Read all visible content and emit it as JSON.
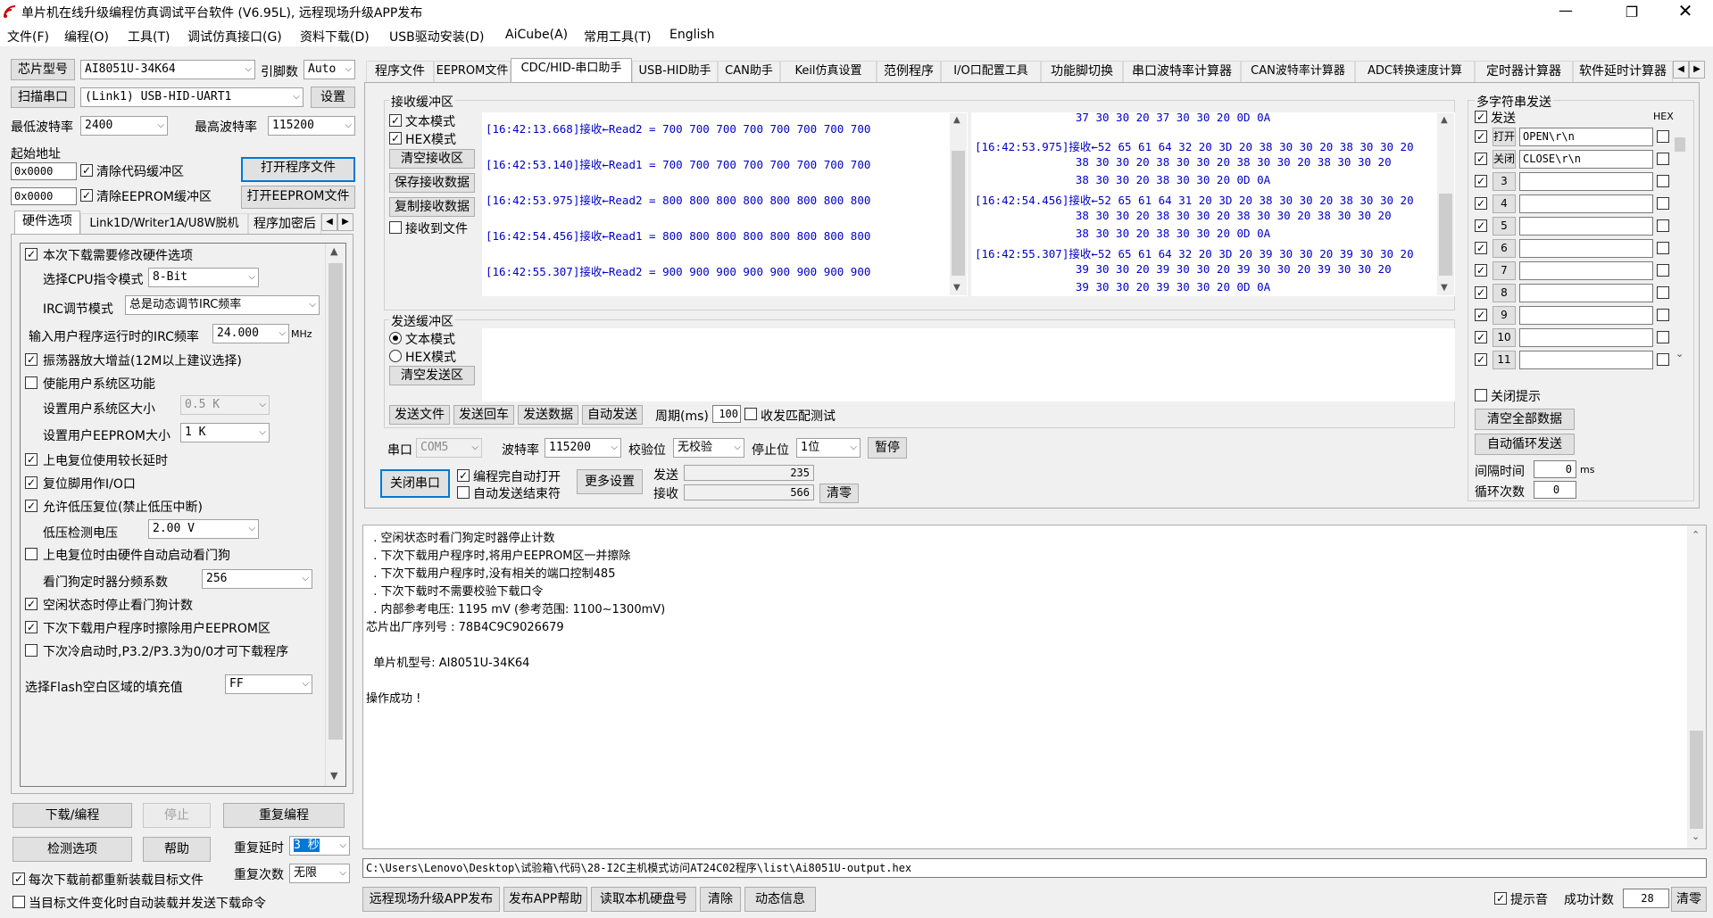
{
  "window": {
    "title": "单片机在线升级编程仿真调试平台软件 (V6.95L), 远程现场升级APP发布"
  },
  "menu": [
    "文件(F)",
    "编程(O)",
    "工具(T)",
    "调试仿真接口(G)",
    "资料下载(D)",
    "USB驱动安装(D)",
    "AiCube(A)",
    "常用工具(T)",
    "English"
  ],
  "left": {
    "chip_btn": "芯片型号",
    "chip": "AI8051U-34K64",
    "pins_lbl": "引脚数",
    "pins": "Auto",
    "scan_btn": "扫描串口",
    "port": "(Link1) USB-HID-UART1",
    "settings_btn": "设置",
    "min_baud_lbl": "最低波特率",
    "min_baud": "2400",
    "max_baud_lbl": "最高波特率",
    "max_baud": "115200",
    "start_addr_lbl": "起始地址",
    "addr1": "0x0000",
    "clear_code_lbl": "清除代码缓冲区",
    "open_prog_btn": "打开程序文件",
    "addr2": "0x0000",
    "clear_eep_lbl": "清除EEPROM缓冲区",
    "open_eep_btn": "打开EEPROM文件",
    "tabs": [
      "硬件选项",
      "Link1D/Writer1A/U8W脱机",
      "程序加密后"
    ],
    "hw": {
      "opt_modify": "本次下载需要修改硬件选项",
      "cpu_lbl": "选择CPU指令模式",
      "cpu": "8-Bit",
      "irc_lbl": "IRC调节模式",
      "irc": "总是动态调节IRC频率",
      "freq_lbl": "输入用户程序运行时的IRC频率",
      "freq": "24.000",
      "freq_unit": "MHz",
      "osc": "振荡器放大增益(12M以上建议选择)",
      "usr_sys": "使能用户系统区功能",
      "usr_sys_size_lbl": "设置用户系统区大小",
      "usr_sys_size": "0.5 K",
      "usr_eep_lbl": "设置用户EEPROM大小",
      "usr_eep": "1   K",
      "por_delay": "上电复位使用较长延时",
      "reset_io": "复位脚用作I/O口",
      "lvr": "允许低压复位(禁止低压中断)",
      "lvd_lbl": "低压检测电压",
      "lvd": "2.00 V",
      "wdt_por": "上电复位时由硬件自动启动看门狗",
      "wdt_div_lbl": "看门狗定时器分频系数",
      "wdt_div": "256",
      "wdt_idle": "空闲状态时停止看门狗计数",
      "erase_eep": "下次下载用户程序时擦除用户EEPROM区",
      "p32": "下次冷启动时,P3.2/P3.3为0/0才可下载程序",
      "fill_lbl": "选择Flash空白区域的填充值",
      "fill": "FF"
    },
    "download_btn": "下载/编程",
    "stop_btn": "停止",
    "reprog_btn": "重复编程",
    "check_btn": "检测选项",
    "help_btn": "帮助",
    "rep_delay_lbl": "重复延时",
    "rep_delay": "3 秒",
    "rep_count_lbl": "重复次数",
    "rep_count": "无限",
    "reload_lbl": "每次下载前都重新装载目标文件",
    "auto_lbl": "当目标文件变化时自动装载并发送下载命令"
  },
  "tabs": [
    "程序文件",
    "EEPROM文件",
    "CDC/HID-串口助手",
    "USB-HID助手",
    "CAN助手",
    "Keil仿真设置",
    "范例程序",
    "I/O口配置工具",
    "功能脚切换",
    "串口波特率计算器",
    "CAN波特率计算器",
    "ADC转换速度计算",
    "定时器计算器",
    "软件延时计算器"
  ],
  "rx": {
    "title": "接收缓冲区",
    "text_mode": "文本模式",
    "hex_mode": "HEX模式",
    "clear_btn": "清空接收区",
    "save_btn": "保存接收数据",
    "copy_btn": "复制接收数据",
    "to_file": "接收到文件",
    "lines": [
      "[16:42:13.668]接收←Read2 = 700 700 700 700 700 700 700 700",
      "[16:42:53.140]接收←Read1 = 700 700 700 700 700 700 700 700",
      "[16:42:53.975]接收←Read2 = 800 800 800 800 800 800 800 800",
      "[16:42:54.456]接收←Read1 = 800 800 800 800 800 800 800 800",
      "[16:42:55.307]接收←Read2 = 900 900 900 900 900 900 900 900"
    ],
    "hex_lines": [
      "               37 30 30 20 37 30 30 20 0D 0A",
      "[16:42:53.975]接收←52 65 61 64 32 20 3D 20 38 30 30 20 38 30 30 20",
      "               38 30 30 20 38 30 30 20 38 30 30 20 38 30 30 20",
      "               38 30 30 20 38 30 30 20 0D 0A",
      "[16:42:54.456]接收←52 65 61 64 31 20 3D 20 38 30 30 20 38 30 30 20",
      "               38 30 30 20 38 30 30 20 38 30 30 20 38 30 30 20",
      "               38 30 30 20 38 30 30 20 0D 0A",
      "[16:42:55.307]接收←52 65 61 64 32 20 3D 20 39 30 30 20 39 30 30 20",
      "               39 30 30 20 39 30 30 20 39 30 30 20 39 30 30 20",
      "               39 30 30 20 39 30 30 20 0D 0A"
    ]
  },
  "tx": {
    "title": "发送缓冲区",
    "text_mode": "文本模式",
    "hex_mode": "HEX模式",
    "clear_btn": "清空发送区",
    "send_file": "发送文件",
    "send_enter": "发送回车",
    "send_data": "发送数据",
    "auto_send": "自动发送",
    "period_lbl": "周期(ms)",
    "period": "100",
    "loop_test": "收发匹配测试"
  },
  "serial": {
    "port_lbl": "串口",
    "port": "COM5",
    "baud_lbl": "波特率",
    "baud": "115200",
    "parity_lbl": "校验位",
    "parity": "无校验",
    "stop_lbl": "停止位",
    "stop": "1位",
    "pause_btn": "暂停",
    "close_btn": "关闭串口",
    "auto_open": "编程完自动打开",
    "auto_end": "自动发送结束符",
    "more_btn": "更多设置",
    "send_lbl": "发送",
    "send_count": "235",
    "recv_lbl": "接收",
    "recv_count": "566",
    "zero_btn": "清零"
  },
  "multi": {
    "title": "多字符串发送",
    "send_lbl": "发送",
    "hex_lbl": "HEX",
    "rows": [
      {
        "btn": "打开",
        "text": "OPEN\\r\\n",
        "checked": true
      },
      {
        "btn": "关闭",
        "text": "CLOSE\\r\\n",
        "checked": true
      },
      {
        "btn": "3",
        "text": "",
        "checked": true
      },
      {
        "btn": "4",
        "text": "",
        "checked": true
      },
      {
        "btn": "5",
        "text": "",
        "checked": true
      },
      {
        "btn": "6",
        "text": "",
        "checked": true
      },
      {
        "btn": "7",
        "text": "",
        "checked": true
      },
      {
        "btn": "8",
        "text": "",
        "checked": true
      },
      {
        "btn": "9",
        "text": "",
        "checked": true
      },
      {
        "btn": "10",
        "text": "",
        "checked": true
      },
      {
        "btn": "11",
        "text": "",
        "checked": true
      }
    ],
    "close_tip": "关闭提示",
    "clear_all_btn": "清空全部数据",
    "auto_loop_btn": "自动循环发送",
    "interval_lbl": "间隔时间",
    "interval": "0",
    "interval_unit": "ms",
    "loop_lbl": "循环次数",
    "loop": "0"
  },
  "output": {
    "lines": [
      "  . 空闲状态时看门狗定时器停止计数",
      "  . 下次下载用户程序时,将用户EEPROM区一并擦除",
      "  . 下次下载用户程序时,没有相关的端口控制485",
      "  . 下次下载时不需要校验下载口令",
      "  . 内部参考电压: 1195 mV (参考范围: 1100~1300mV)",
      "芯片出厂序列号 : 78B4C9C9026679",
      "",
      "  单片机型号: AI8051U-34K64",
      "",
      "操作成功 !"
    ]
  },
  "path": "C:\\Users\\Lenovo\\Desktop\\试验箱\\代码\\28-I2C主机模式访问AT24C02程序\\list\\Ai8051U-output.hex",
  "bottom": {
    "remote_btn": "远程现场升级APP发布",
    "pub_help_btn": "发布APP帮助",
    "read_disk_btn": "读取本机硬盘号",
    "clear_btn": "清除",
    "dyn_btn": "动态信息",
    "tip_lbl": "提示音",
    "success_lbl": "成功计数",
    "success": "28",
    "zero_btn": "清零"
  }
}
